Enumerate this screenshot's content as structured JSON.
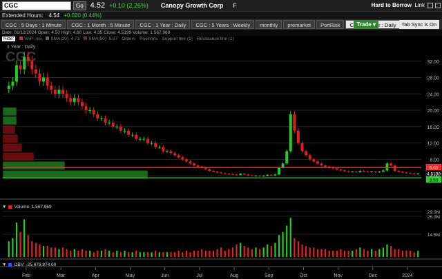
{
  "quote": {
    "symbol": "CGC",
    "go_label": "Go",
    "last_price": "4.52",
    "change": "+0.10 (2.26%)",
    "company": "Canopy Growth Corp",
    "exchange": "F",
    "hard_to_borrow": "Hard to Borrow",
    "link_label": "Link"
  },
  "extended": {
    "label": "Extended Hours:",
    "price": "4.54",
    "change": "+0.020 (0.44%)"
  },
  "tabs": [
    {
      "label": "CGC : 5 Days : 1 Minute"
    },
    {
      "label": "CGC : 1 Month : 5 Minute"
    },
    {
      "label": "CGC : 1 Year : Daily"
    },
    {
      "label": "CGC : 5 Years : Weekly"
    },
    {
      "label": "monthly"
    },
    {
      "label": "premarket"
    },
    {
      "label": "PortRisk"
    },
    {
      "label": "CGC : 1 Year : Daily"
    }
  ],
  "toolbar": {
    "trade_label": "Trade ▾",
    "sync_label": "Tab Sync is On"
  },
  "ohlc_line": "Date: 01/12/2024   Open: 4.50   High: 4.60   Low: 4.35   Close: 4.5199   Volume: 1,567,969",
  "indicators": {
    "hide_label": "Hide:",
    "items": [
      "VAP: n/a",
      "SMA(20): 4.73",
      "SMA(50): 5.57",
      "Orders",
      "Positions",
      "Support line (1)",
      "Resistance line (1)"
    ]
  },
  "chart_labels": {
    "period": "1 Year : Daily",
    "watermark": "CGC",
    "volume_label": "Volume: 1,567,969",
    "obv_label": "OBV: -25,678,874.00",
    "price_tag_resistance": "6.00",
    "price_tag_last": "4.5199",
    "price_tag_support": "3.50"
  },
  "colors": {
    "up": "#22cc22",
    "down": "#e02020",
    "resistance": "#ff2020",
    "support": "#2ecc2e",
    "vap_buy": "#1f7a1f",
    "vap_sell": "#7a1010"
  },
  "chart_data": {
    "type": "candlestick",
    "y_axis_ticks": [
      "32.00",
      "28.00",
      "24.00",
      "20.00",
      "16.00",
      "12.00",
      "8.00",
      "4.00"
    ],
    "ylim": [
      2.5,
      36
    ],
    "x_axis_labels": [
      "Feb",
      "Mar",
      "Apr",
      "May",
      "Jun",
      "Jul",
      "Aug",
      "Sep",
      "Oct",
      "Nov",
      "Dec",
      "2024"
    ],
    "resistance_level": 6.0,
    "support_level": 3.5,
    "last_close": 4.5199,
    "closes": [
      26,
      27,
      31,
      30,
      33,
      32,
      30,
      29,
      27,
      28,
      26,
      25,
      24,
      25,
      24,
      23,
      22,
      23,
      22,
      21,
      20,
      20,
      19,
      18,
      18,
      17,
      17,
      16,
      16,
      15,
      15,
      14,
      14,
      13,
      13,
      13,
      12,
      12,
      11,
      11,
      10,
      10,
      9.5,
      9,
      8.5,
      8,
      7.5,
      7,
      6.5,
      6.2,
      6,
      5.6,
      5.2,
      5,
      4.8,
      4.6,
      4.5,
      4.4,
      4.3,
      4.2,
      4.5,
      4.3,
      4.1,
      4,
      4,
      3.9,
      4,
      4.2,
      4.1,
      4.3,
      6,
      7,
      10,
      19,
      15,
      12,
      10,
      9,
      8,
      7.5,
      7,
      6.5,
      6.2,
      6,
      5.8,
      5.5,
      5.3,
      5.1,
      5,
      5,
      4.9,
      5.2,
      5.1,
      5,
      5,
      4.9,
      5,
      5.3,
      7,
      6.5,
      5.2,
      5,
      4.8,
      4.7,
      4.6,
      4.5,
      4.52
    ],
    "volume_ymax": "29.0M",
    "volume_ticks": [
      "26.0M",
      "14.5M"
    ],
    "volumes_millions": [
      10,
      12,
      22,
      16,
      24,
      14,
      10,
      9,
      8,
      7,
      7,
      6,
      6,
      5,
      6,
      5,
      4,
      5,
      4,
      5,
      4,
      4,
      3,
      4,
      4,
      5,
      4,
      3,
      4,
      3,
      4,
      3,
      3,
      4,
      3,
      3,
      3,
      3,
      4,
      3,
      3,
      3,
      3,
      3,
      4,
      3,
      4,
      3,
      4,
      4,
      5,
      4,
      4,
      4,
      5,
      6,
      4,
      5,
      6,
      8,
      9,
      7,
      6,
      5,
      6,
      5,
      6,
      8,
      7,
      9,
      14,
      16,
      20,
      25,
      12,
      10,
      8,
      7,
      6,
      6,
      5,
      5,
      5,
      4,
      4,
      4,
      5,
      4,
      4,
      4,
      5,
      6,
      5,
      4,
      5,
      4,
      5,
      6,
      8,
      7,
      5,
      5,
      4,
      4,
      4,
      3,
      4
    ]
  }
}
